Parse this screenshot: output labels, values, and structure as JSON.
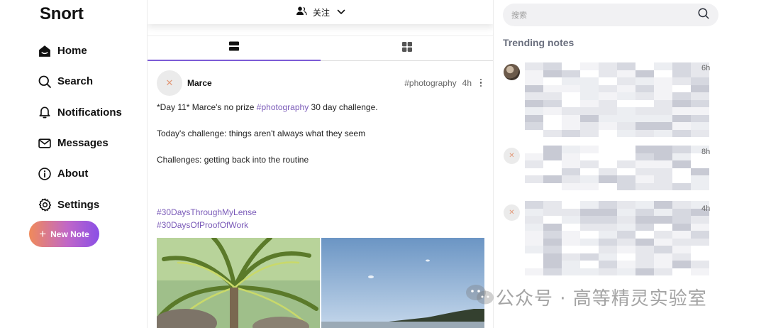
{
  "app": {
    "name": "Snort"
  },
  "sidebar": {
    "items": [
      {
        "label": "Home",
        "icon": "home-icon"
      },
      {
        "label": "Search",
        "icon": "search-icon"
      },
      {
        "label": "Notifications",
        "icon": "bell-icon"
      },
      {
        "label": "Messages",
        "icon": "mail-icon"
      },
      {
        "label": "About",
        "icon": "info-icon"
      },
      {
        "label": "Settings",
        "icon": "gear-icon"
      }
    ],
    "new_note_label": "New Note"
  },
  "feed": {
    "topbar_title": "关注",
    "tabs": [
      {
        "name": "list-view",
        "icon": "list-view-icon",
        "active": true
      },
      {
        "name": "grid-view",
        "icon": "grid-view-icon",
        "active": false
      }
    ],
    "post": {
      "author": "Marce",
      "tag": "#photography",
      "time": "4h",
      "line1_prefix": "*Day 11* Marce's no prize ",
      "line1_hashtag": "#photography",
      "line1_suffix": " 30 day challenge.",
      "line2": "Today's challenge: things aren't always what they seem",
      "line3": "Challenges: getting back into the routine",
      "hashtags": [
        "#30DaysThroughMyLense",
        "#30DaysOfProofOfWork"
      ]
    }
  },
  "right": {
    "search_placeholder": "搜索",
    "trending_title": "Trending notes",
    "notes": [
      {
        "time": "6h"
      },
      {
        "time": "8h"
      },
      {
        "time": "4h"
      }
    ]
  },
  "watermark": "公众号 · 高等精灵实验室",
  "colors": {
    "accent": "#7c5cd6",
    "hashtag": "#7a5ab8",
    "gradient_start": "#f08a5a",
    "gradient_end": "#8a4fe6"
  }
}
